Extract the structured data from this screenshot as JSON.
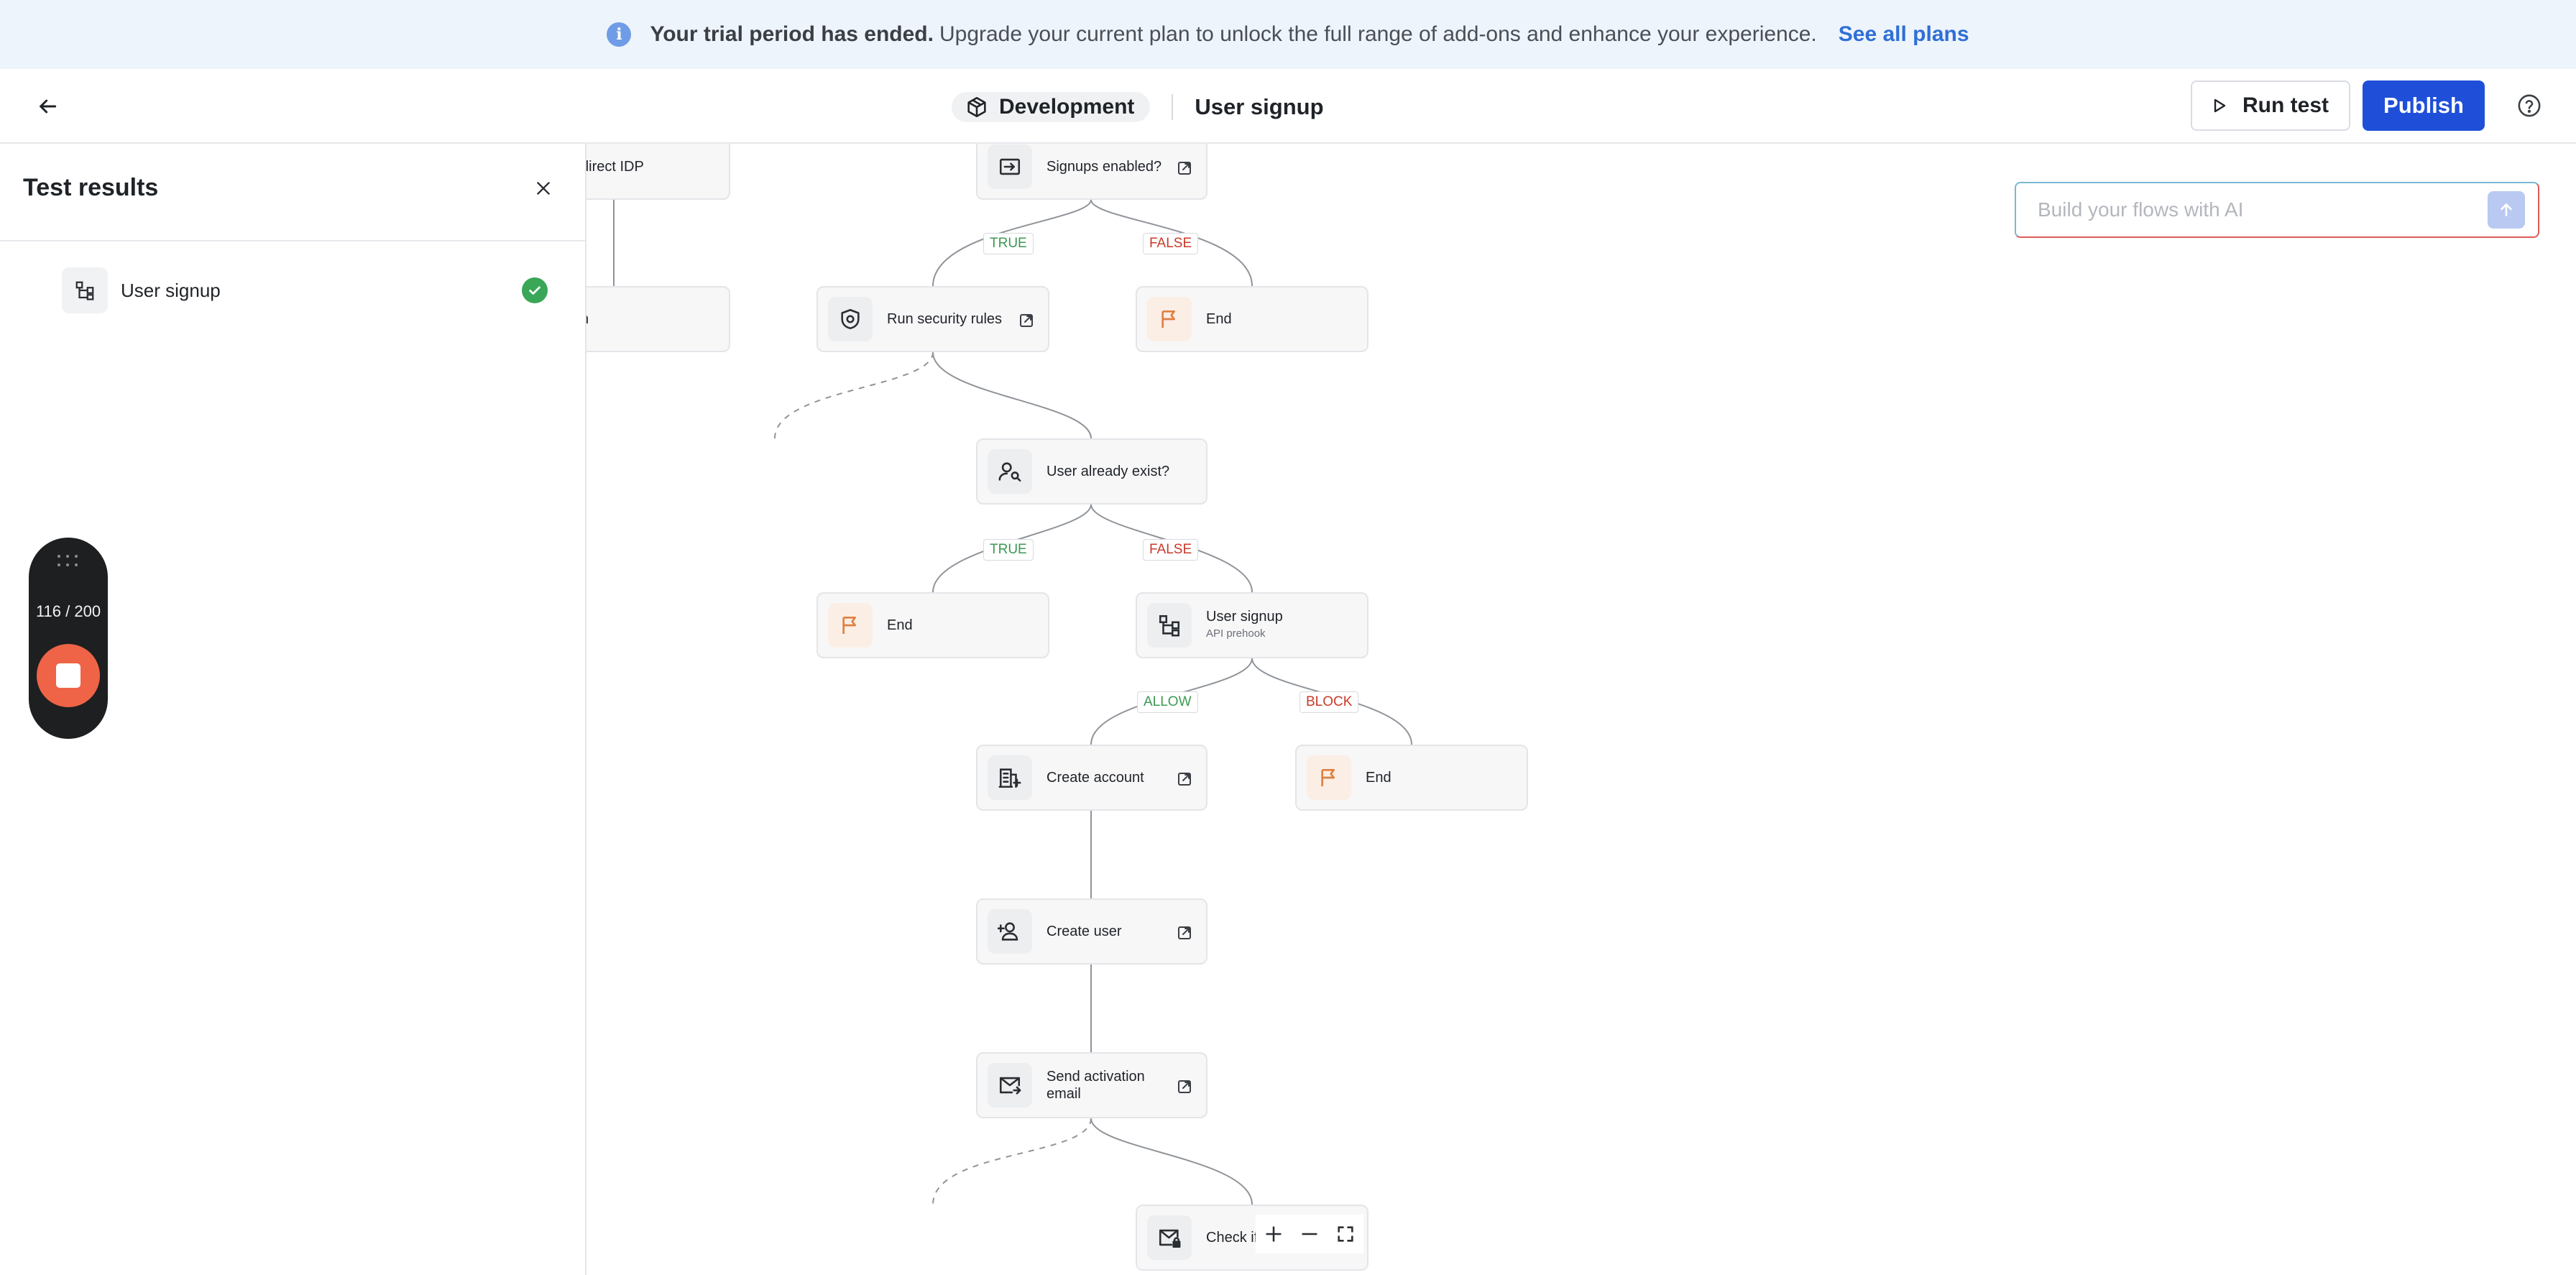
{
  "banner": {
    "icon": "info-icon",
    "strong_text": "Your trial period has ended.",
    "text": "Upgrade your current plan to unlock the full range of add-ons and enhance your experience.",
    "link": "See all plans"
  },
  "header": {
    "back_icon": "arrow-left-icon",
    "environment": "Development",
    "flow_title": "User signup",
    "run_test_label": "Run test",
    "publish_label": "Publish",
    "help_icon": "help-circle-icon"
  },
  "panel": {
    "title": "Test results",
    "items": [
      {
        "label": "User signup",
        "status": "success"
      }
    ]
  },
  "recorder": {
    "count": "116 / 200"
  },
  "ai": {
    "placeholder": "Build your flows with AI"
  },
  "flow": {
    "nodes": {
      "redirect_idp": "direct IDP",
      "partial_left": "n",
      "signups_enabled": "Signups enabled?",
      "run_security_rules": "Run security rules",
      "end_1": "End",
      "user_already_exist": "User already exist?",
      "end_2": "End",
      "user_signup": "User signup",
      "user_signup_sub": "API prehook",
      "create_account": "Create account",
      "end_3": "End",
      "create_user": "Create user",
      "send_activation": "Send activation email",
      "check_if": "Check if"
    },
    "edges": {
      "true_1": "TRUE",
      "false_1": "FALSE",
      "true_2": "TRUE",
      "false_2": "FALSE",
      "allow": "ALLOW",
      "block": "BLOCK"
    }
  },
  "colors": {
    "publish": "#1f4fd9",
    "true_label": "#3a9a52",
    "false_label": "#c83a2a",
    "success": "#3aa657",
    "recorder_stop": "#ef6446"
  }
}
